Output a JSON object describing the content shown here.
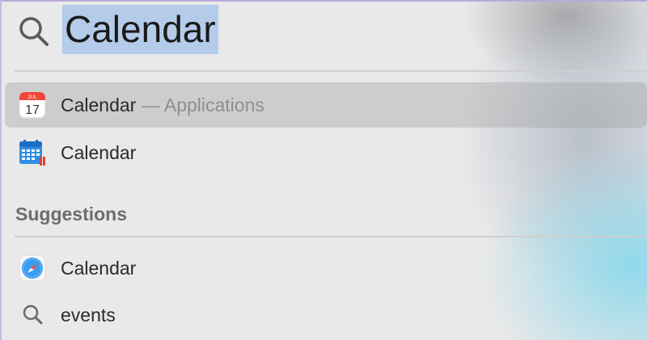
{
  "search": {
    "query": "Calendar"
  },
  "results": [
    {
      "label": "Calendar",
      "subtitle": " — Applications",
      "icon": "calendar-app-icon",
      "selected": true,
      "icon_text_month": "JUL",
      "icon_text_day": "17"
    },
    {
      "label": "Calendar",
      "icon": "calendar-grid-icon",
      "selected": false
    }
  ],
  "suggestions": {
    "title": "Suggestions",
    "items": [
      {
        "label": "Calendar",
        "icon": "safari-compass-icon"
      },
      {
        "label": "events",
        "icon": "search-icon"
      }
    ]
  },
  "colors": {
    "selection_highlight": "#b4cbea",
    "selected_row": "#c4c4c4",
    "secondary_text": "#8e8e8e",
    "section_title": "#6d6d6d",
    "accent_cyan": "#82d7eb"
  }
}
